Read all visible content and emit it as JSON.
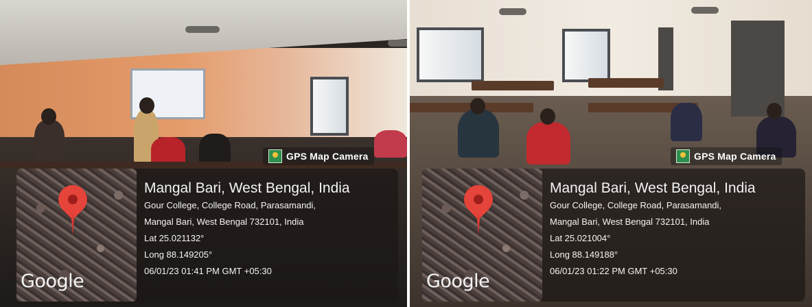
{
  "photos": [
    {
      "gps_badge": "GPS Map Camera",
      "map_brand": "Google",
      "location_title": "Mangal Bari, West Bengal, India",
      "address_line1": "Gour College, College Road, Parasamandi,",
      "address_line2": "Mangal Bari, West Bengal 732101, India",
      "latitude": "Lat 25.021132°",
      "longitude": "Long 88.149205°",
      "timestamp": "06/01/23 01:41 PM GMT +05:30"
    },
    {
      "gps_badge": "GPS Map Camera",
      "map_brand": "Google",
      "location_title": "Mangal Bari, West Bengal, India",
      "address_line1": "Gour College, College Road, Parasamandi,",
      "address_line2": "Mangal Bari, West Bengal 732101, India",
      "latitude": "Lat 25.021004°",
      "longitude": "Long 88.149188°",
      "timestamp": "06/01/23 01:22 PM GMT +05:30"
    }
  ],
  "icons": {
    "gps_logo": "gps-map-camera-icon",
    "map_pin": "map-pin-icon"
  },
  "colors": {
    "pin": "#e5443b",
    "panel": "#1c1816"
  }
}
